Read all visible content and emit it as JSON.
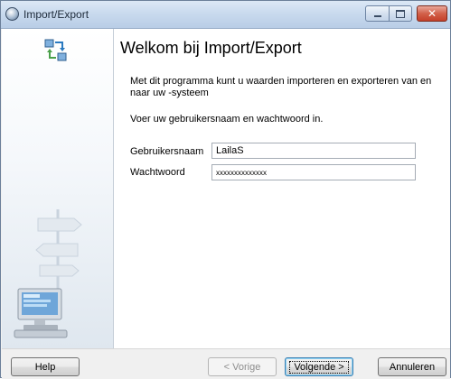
{
  "window": {
    "title": "Import/Export",
    "controls": {
      "minimize_icon": "minimize-icon",
      "maximize_icon": "maximize-icon",
      "close_icon": "close-icon"
    }
  },
  "sidebar": {
    "top_icon": "sync-arrows-icon",
    "illustration": "signpost-computer-illustration"
  },
  "main": {
    "heading": "Welkom bij Import/Export",
    "intro": "Met dit programma kunt u waarden importeren en exporteren van en naar uw -systeem",
    "prompt": "Voer uw gebruikersnaam en wachtwoord in.",
    "username_label": "Gebruikersnaam",
    "username_value": "LailaS",
    "password_label": "Wachtwoord",
    "password_value": "xxxxxxxxxxxxxx"
  },
  "footer": {
    "help": "Help",
    "previous": "< Vorige",
    "next": "Volgende >",
    "cancel": "Annuleren"
  },
  "colors": {
    "titlebar": "#c9daee",
    "close_button": "#c5402a",
    "content_bg": "#ffffff",
    "footer_bg": "#f0f0f0"
  }
}
